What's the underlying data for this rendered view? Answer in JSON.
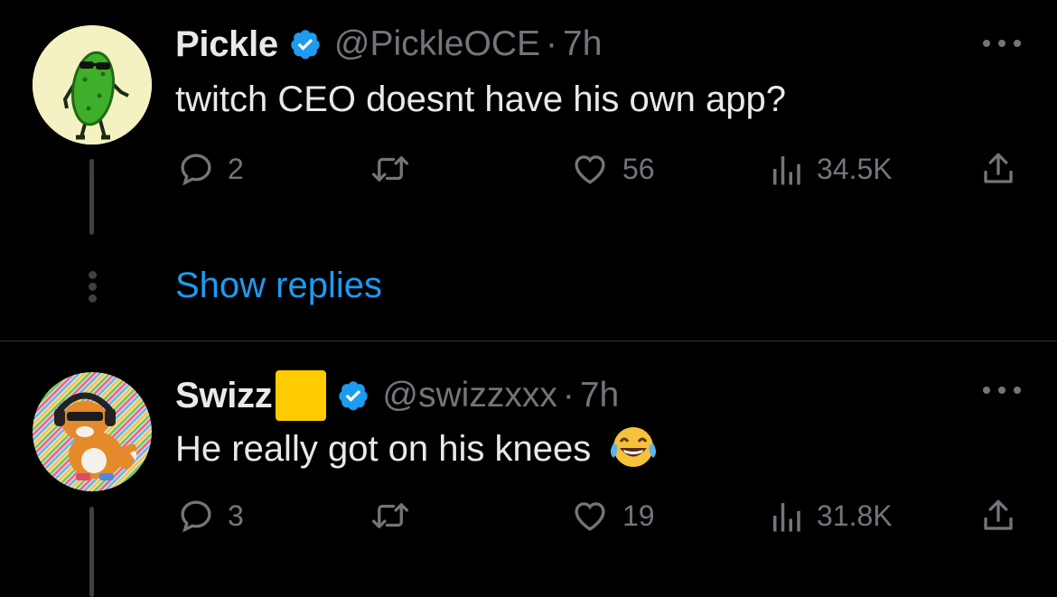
{
  "tweets": [
    {
      "display_name": "Pickle",
      "handle": "@PickleOCE",
      "separator": "·",
      "time": "7h",
      "text": "twitch CEO doesnt have his own app?",
      "replies": "2",
      "likes": "56",
      "views": "34.5K",
      "show_replies_label": "Show replies"
    },
    {
      "display_name": "Swizz",
      "handle": "@swizzxxx",
      "separator": "·",
      "time": "7h",
      "text": "He really got on his knees",
      "replies": "3",
      "likes": "19",
      "views": "31.8K"
    }
  ],
  "colors": {
    "background": "#000000",
    "text": "#e7e9ea",
    "muted": "#71767b",
    "accent": "#1d9bf0",
    "divider": "#2f3336"
  }
}
